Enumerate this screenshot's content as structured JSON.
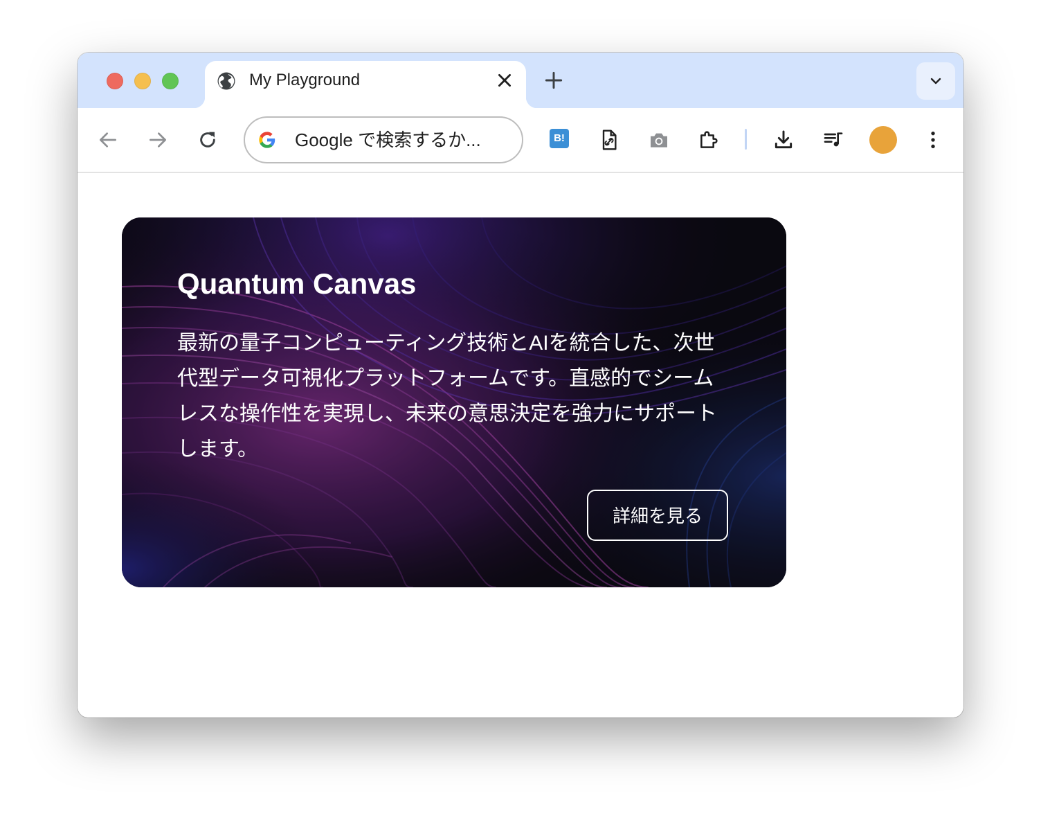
{
  "browser": {
    "tab_title": "My Playground",
    "omnibox_text": "Google で検索するか...",
    "colors": {
      "titlebar": "#d3e3fd",
      "avatar": "#e8a33a",
      "close_button": "#ee6a5f",
      "minimize_button": "#f5bf4f",
      "zoom_button": "#61c554"
    },
    "toolbar_icons": [
      "back-arrow-icon",
      "forward-arrow-icon",
      "reload-icon",
      "hatena-bookmark-icon",
      "page-link-icon",
      "camera-icon",
      "extensions-puzzle-icon",
      "download-icon",
      "media-queue-icon",
      "more-vert-icon"
    ],
    "hatena_label": "B!"
  },
  "card": {
    "title": "Quantum Canvas",
    "description": "最新の量子コンピューティング技術とAIを統合した、次世代型データ可視化プラットフォームです。直感的でシームレスな操作性を実現し、未来の意思決定を強力にサポートします。",
    "button_label": "詳細を見る"
  }
}
